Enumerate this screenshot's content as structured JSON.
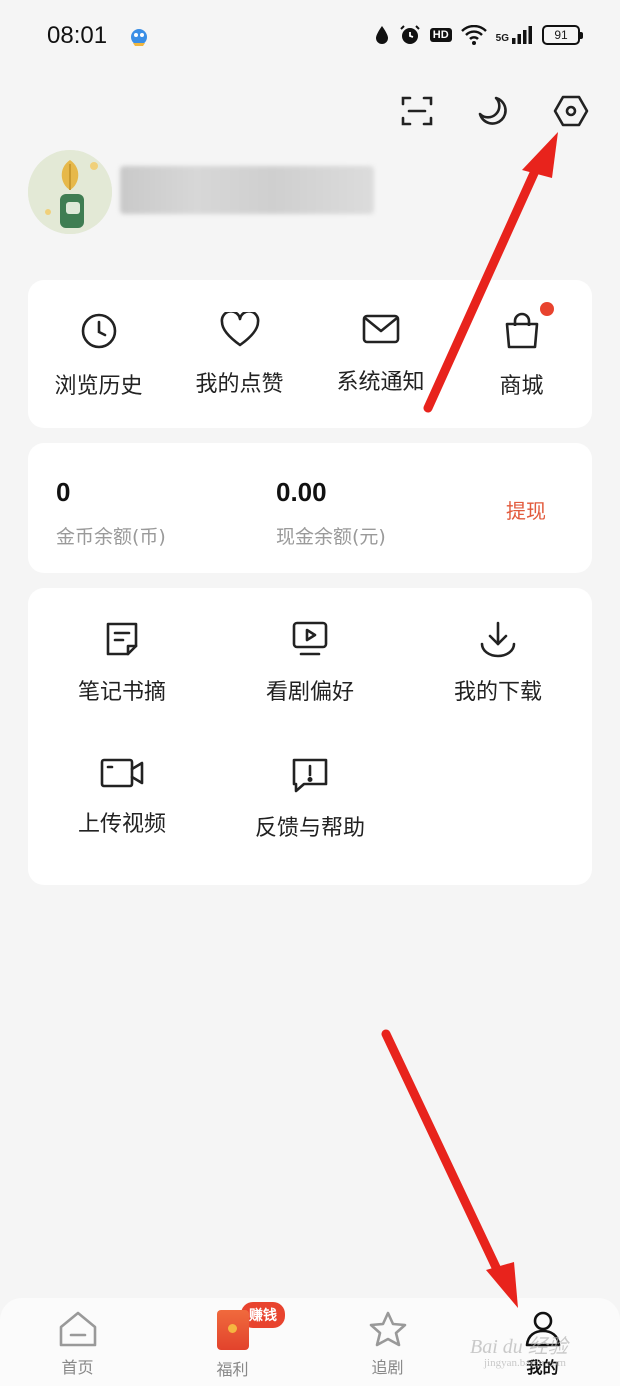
{
  "status_bar": {
    "time": "08:01",
    "hd_label": "HD",
    "network_label": "5G",
    "battery": "91"
  },
  "top_actions": {
    "scan_icon": "scan-icon",
    "night_mode_icon": "moon-icon",
    "settings_icon": "hexagon-settings-icon"
  },
  "quick_links": [
    {
      "label": "浏览历史",
      "icon": "clock-icon"
    },
    {
      "label": "我的点赞",
      "icon": "heart-icon"
    },
    {
      "label": "系统通知",
      "icon": "mail-icon"
    },
    {
      "label": "商城",
      "icon": "shopping-bag-icon",
      "has_dot": true
    }
  ],
  "wallet": {
    "coins_value": "0",
    "coins_label": "金币余额(币)",
    "cash_value": "0.00",
    "cash_label": "现金余额(元)",
    "withdraw_label": "提现"
  },
  "tools": [
    {
      "label": "笔记书摘",
      "icon": "note-icon"
    },
    {
      "label": "看剧偏好",
      "icon": "video-screen-icon"
    },
    {
      "label": "我的下载",
      "icon": "download-icon"
    },
    {
      "label": "上传视频",
      "icon": "video-camera-icon"
    },
    {
      "label": "反馈与帮助",
      "icon": "feedback-icon"
    }
  ],
  "bottom_nav": {
    "items": [
      {
        "label": "首页",
        "icon": "home-icon"
      },
      {
        "label": "福利",
        "icon": "red-envelope-icon",
        "badge": "赚钱"
      },
      {
        "label": "追剧",
        "icon": "star-icon"
      },
      {
        "label": "我的",
        "icon": "person-icon",
        "active": true
      }
    ]
  },
  "watermark": {
    "text": "Bai du 经验",
    "sub": "jingyan.baidu.com"
  },
  "colors": {
    "accent": "#e8432e",
    "withdraw": "#e25a3c",
    "background": "#f5f5f5",
    "card": "#ffffff",
    "arrow": "#e8231c"
  }
}
